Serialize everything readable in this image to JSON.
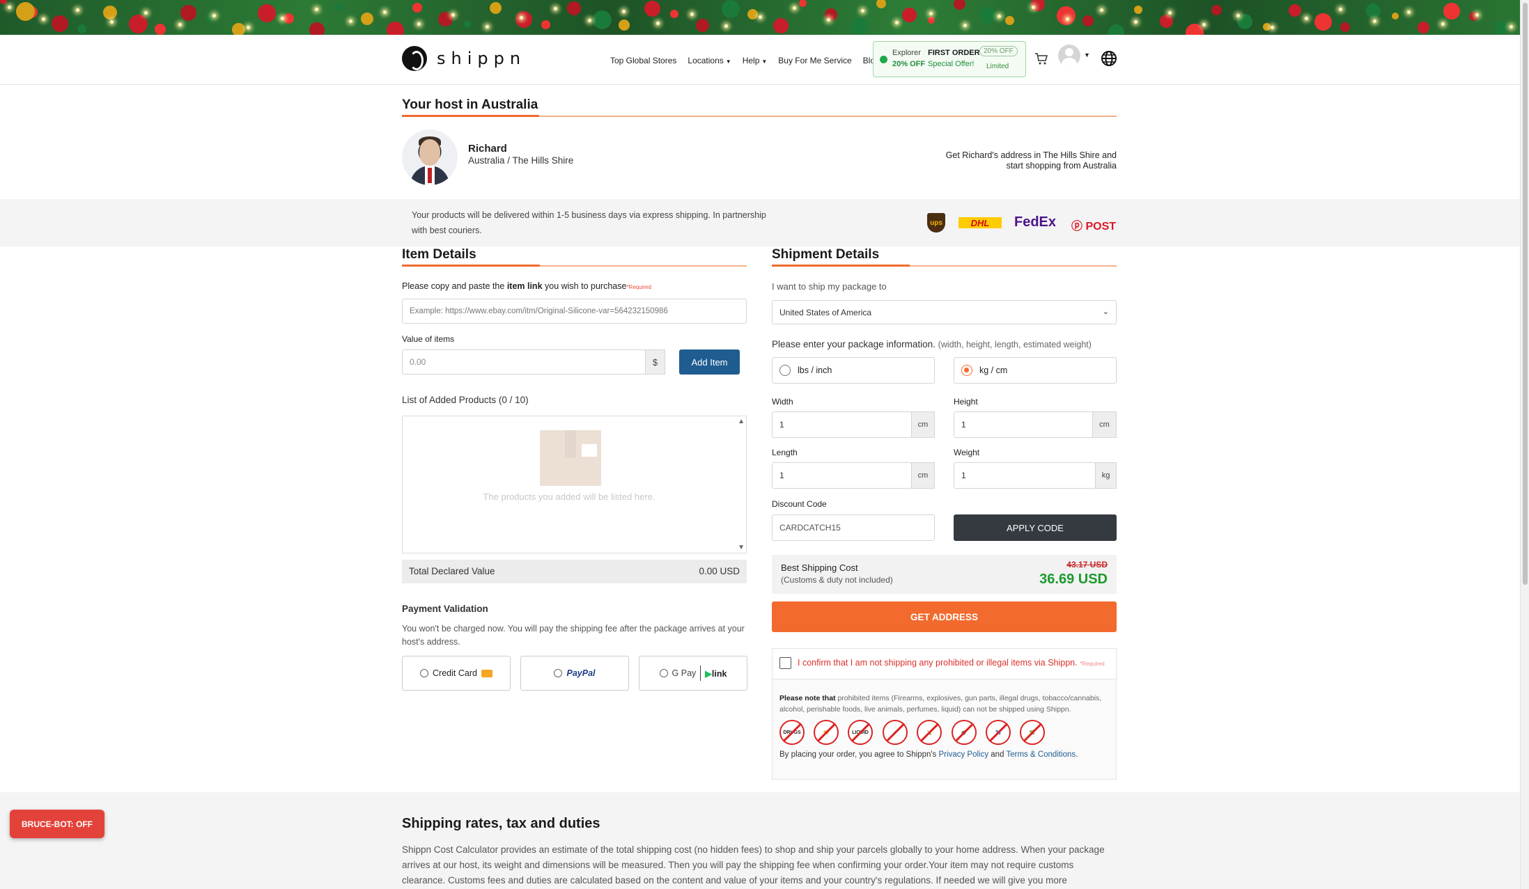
{
  "nav": {
    "logo": "shippn",
    "menu": [
      {
        "label": "Top Global Stores",
        "dropdown": false
      },
      {
        "label": "Locations",
        "dropdown": true
      },
      {
        "label": "Help",
        "dropdown": true
      },
      {
        "label": "Buy For Me Service",
        "dropdown": false
      },
      {
        "label": "Blog",
        "dropdown": false
      }
    ],
    "promo": {
      "explorer": "Explorer",
      "percent": "20% OFF",
      "first_order": "FIRST ORDER",
      "special": "Special Offer!",
      "badge": "20% OFF",
      "limited": "Limited"
    }
  },
  "host": {
    "section_title": "Your host in Australia",
    "name": "Richard",
    "location": "Australia / The Hills Shire",
    "cta_line1": "Get Richard's address in The Hills Shire and",
    "cta_line2": "start shopping from Australia"
  },
  "delivery": {
    "text_line1": "Your products will be delivered within 1-5 business days via express shipping. In partnership",
    "text_line2": "with best couriers.",
    "carriers": [
      "ups",
      "DHL",
      "FedEx",
      "POST"
    ]
  },
  "item_details": {
    "title": "Item Details",
    "link_prompt_pre": "Please copy and paste the ",
    "link_prompt_bold": "item link",
    "link_prompt_post": " you wish to purchase",
    "required": "*Required",
    "link_placeholder": "Example: https://www.ebay.com/itm/Original-Silicone-var=564232150986",
    "value_label": "Value of items",
    "value_placeholder": "0.00",
    "currency": "$",
    "add_button": "Add Item",
    "list_title": "List of Added Products (0 / 10)",
    "empty_text": "The products you added will be listed here.",
    "total_label": "Total Declared Value",
    "total_value": "0.00 USD"
  },
  "payment": {
    "title": "Payment Validation",
    "text_line1": "You won't be charged now. You will pay the shipping fee after the package arrives at your",
    "text_line2": "host's address.",
    "options": [
      "Credit Card",
      "PayPal",
      "G Pay",
      "link"
    ]
  },
  "shipment": {
    "title": "Shipment Details",
    "ship_to_label": "I want to ship my package to",
    "country": "United States of America",
    "package_info": "Please enter your package information.",
    "package_hint": "(width, height, length, estimated weight)",
    "units": [
      {
        "label": "lbs / inch",
        "selected": false
      },
      {
        "label": "kg / cm",
        "selected": true
      }
    ],
    "width": {
      "label": "Width",
      "value": "1",
      "unit": "cm"
    },
    "height": {
      "label": "Height",
      "value": "1",
      "unit": "cm"
    },
    "length": {
      "label": "Length",
      "value": "1",
      "unit": "cm"
    },
    "weight": {
      "label": "Weight",
      "value": "1",
      "unit": "kg"
    },
    "discount_label": "Discount Code",
    "discount_value": "CARDCATCH15",
    "apply_button": "APPLY CODE",
    "best_cost_label": "Best Shipping Cost",
    "best_cost_note": "(Customs & duty not included)",
    "old_price": "43.17 USD",
    "new_price": "36.69 USD",
    "get_address": "GET ADDRESS",
    "confirm_text": "I confirm that I am not shipping any prohibited or illegal items via Shippn.",
    "required": "*Required",
    "note_bold": "Please note that",
    "note_text_line1": " prohibited items (Firearms, explosives, gun parts, illegal drugs, tobacco/cannabis,",
    "note_text_line2": "alcohol, perishable foods, live animals, perfumes, liquid) can not be shipped using Shippn.",
    "prohibited_icons": [
      "DRUGS",
      "gun",
      "LIQUID",
      "syringe",
      "alcohol",
      "explosive",
      "animal",
      "cannabis"
    ],
    "agree_pre": "By placing your order, you agree to Shippn's ",
    "privacy": "Privacy Policy",
    "and": " and ",
    "terms": "Terms & Conditions",
    "agree_post": "."
  },
  "rates": {
    "title": "Shipping rates, tax and duties",
    "text_line1": "Shippn Cost Calculator provides an estimate of the total shipping cost (no hidden fees) to shop and ship your parcels globally to your home address. When your package",
    "text_line2": "arrives at our host, its weight and dimensions will be measured. Then you will pay the shipping fee when confirming your order.Your item may not require customs",
    "text_line3": "clearance. Customs fees and duties are calculated based on the content and value of your items and your country's regulations. If needed we will give you more"
  },
  "bot": {
    "label": "BRUCE-BOT: OFF"
  },
  "colors": {
    "accent": "#f26a2e",
    "primary_btn": "#1f5d91",
    "dark_btn": "#343a40",
    "price_green": "#1c9a2c",
    "error_red": "#d9312b"
  }
}
